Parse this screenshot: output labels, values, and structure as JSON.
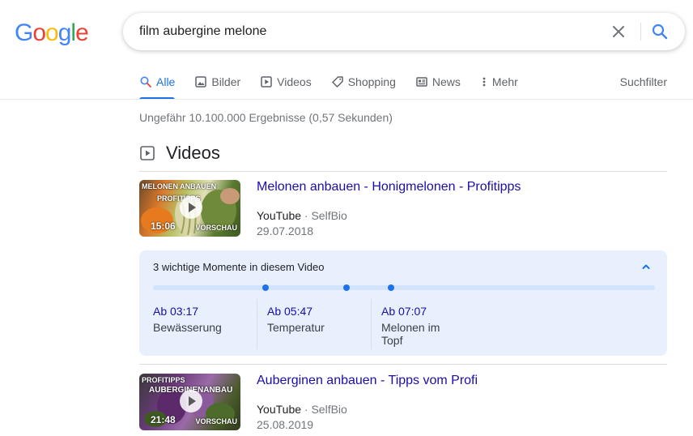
{
  "header": {
    "logo_letters": [
      {
        "ch": "G",
        "color": "#4285F4"
      },
      {
        "ch": "o",
        "color": "#EA4335"
      },
      {
        "ch": "o",
        "color": "#FBBC05"
      },
      {
        "ch": "g",
        "color": "#4285F4"
      },
      {
        "ch": "l",
        "color": "#34A853"
      },
      {
        "ch": "e",
        "color": "#EA4335"
      }
    ],
    "query": "film aubergine melone"
  },
  "tabs": [
    {
      "label": "Alle",
      "icon": "search-icon",
      "active": true
    },
    {
      "label": "Bilder",
      "icon": "image-icon"
    },
    {
      "label": "Videos",
      "icon": "video-icon"
    },
    {
      "label": "Shopping",
      "icon": "tag-icon"
    },
    {
      "label": "News",
      "icon": "newspaper-icon"
    },
    {
      "label": "Mehr",
      "icon": "more-vert-icon"
    }
  ],
  "filter_label": "Suchfilter",
  "stats": "Ungefähr 10.100.000 Ergebnisse (0,57 Sekunden)",
  "section_title": "Videos",
  "videos": [
    {
      "title": "Melonen anbauen - Honigmelonen - Profitipps",
      "platform": "YouTube",
      "separator": "·",
      "channel": "SelfBio",
      "date": "29.07.2018",
      "duration": "15:06",
      "thumb_text_top": "MELONEN ANBAUEN",
      "thumb_text_top2": "PROFITIPPS",
      "thumb_text_preview": "VORSCHAU"
    },
    {
      "title": "Auberginen anbauen - Tipps vom Profi",
      "platform": "YouTube",
      "separator": "·",
      "channel": "SelfBio",
      "date": "25.08.2019",
      "duration": "21:48",
      "thumb_text_top": "PROFITIPPS",
      "thumb_text_top2": "AUBERGINENANBAU",
      "thumb_text_preview": "VORSCHAU"
    }
  ],
  "moments": {
    "heading": "3 wichtige Momente in diesem Video",
    "items": [
      {
        "time": "Ab 03:17",
        "label": "Bewässerung"
      },
      {
        "time": "Ab 05:47",
        "label": "Temperatur"
      },
      {
        "time": "Ab 07:07",
        "label": "Melonen im Topf"
      }
    ]
  },
  "colors": {
    "link": "#1a0dab",
    "accent": "#1a73e8",
    "moments_bg": "#e8f0fe"
  }
}
